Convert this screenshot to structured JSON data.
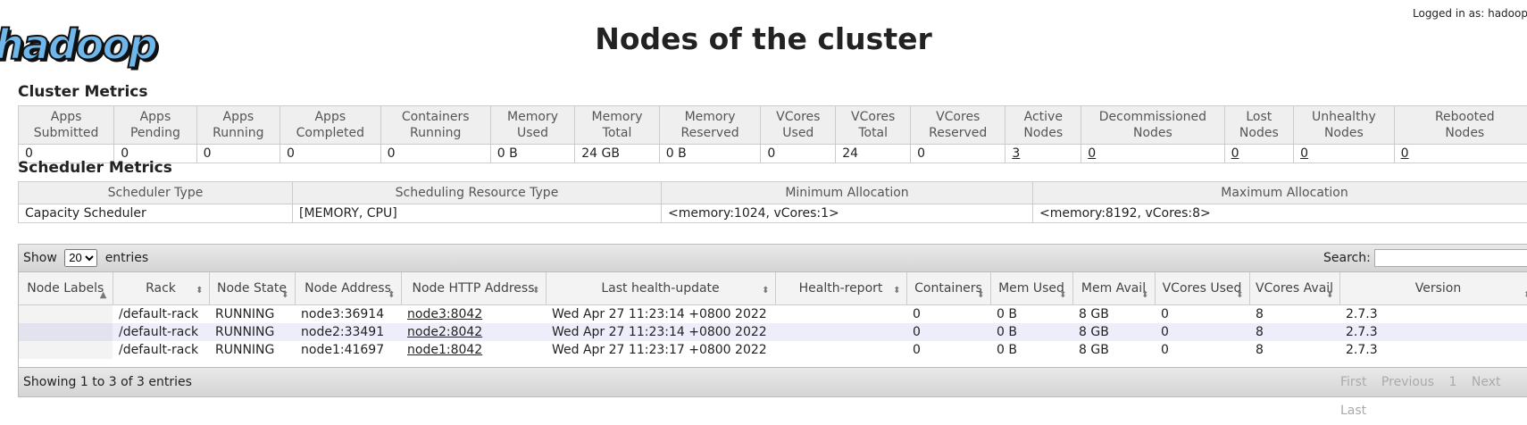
{
  "logo_text": "hadoop",
  "login_text": "Logged in as: hadoop",
  "page_title": "Nodes of the cluster",
  "cluster_metrics": {
    "title": "Cluster Metrics",
    "headers": [
      "Apps\nSubmitted",
      "Apps\nPending",
      "Apps\nRunning",
      "Apps\nCompleted",
      "Containers\nRunning",
      "Memory\nUsed",
      "Memory\nTotal",
      "Memory\nReserved",
      "VCores\nUsed",
      "VCores\nTotal",
      "VCores\nReserved",
      "Active\nNodes",
      "Decommissioned\nNodes",
      "Lost\nNodes",
      "Unhealthy\nNodes",
      "Rebooted\nNodes"
    ],
    "values": [
      "0",
      "0",
      "0",
      "0",
      "0",
      "0 B",
      "24 GB",
      "0 B",
      "0",
      "24",
      "0",
      "3",
      "0",
      "0",
      "0",
      "0"
    ]
  },
  "scheduler_metrics": {
    "title": "Scheduler Metrics",
    "headers": [
      "Scheduler Type",
      "Scheduling Resource Type",
      "Minimum Allocation",
      "Maximum Allocation"
    ],
    "values": [
      "Capacity Scheduler",
      "[MEMORY, CPU]",
      "<memory:1024, vCores:1>",
      "<memory:8192, vCores:8>"
    ]
  },
  "nodes_table": {
    "show_label": "Show",
    "entries_label": "entries",
    "page_size": "20",
    "search_label": "Search:",
    "search_value": "",
    "headers": [
      "Node Labels",
      "Rack",
      "Node State",
      "Node Address",
      "Node HTTP Address",
      "Last health-update",
      "Health-report",
      "Containers",
      "Mem Used",
      "Mem Avail",
      "VCores Used",
      "VCores Avail",
      "Version"
    ],
    "rows": [
      [
        "",
        "/default-rack",
        "RUNNING",
        "node3:36914",
        "node3:8042",
        "Wed Apr 27 11:23:14 +0800 2022",
        "",
        "0",
        "0 B",
        "8 GB",
        "0",
        "8",
        "2.7.3"
      ],
      [
        "",
        "/default-rack",
        "RUNNING",
        "node2:33491",
        "node2:8042",
        "Wed Apr 27 11:23:14 +0800 2022",
        "",
        "0",
        "0 B",
        "8 GB",
        "0",
        "8",
        "2.7.3"
      ],
      [
        "",
        "/default-rack",
        "RUNNING",
        "node1:41697",
        "node1:8042",
        "Wed Apr 27 11:23:17 +0800 2022",
        "",
        "0",
        "0 B",
        "8 GB",
        "0",
        "8",
        "2.7.3"
      ]
    ],
    "info": "Showing 1 to 3 of 3 entries",
    "pager": {
      "first": "First",
      "previous": "Previous",
      "page": "1",
      "next": "Next",
      "last": "Last"
    }
  },
  "colors": {
    "logo": "#6fb7ea",
    "row_alt": "#eeeefa",
    "header_bg": "#efefef"
  }
}
